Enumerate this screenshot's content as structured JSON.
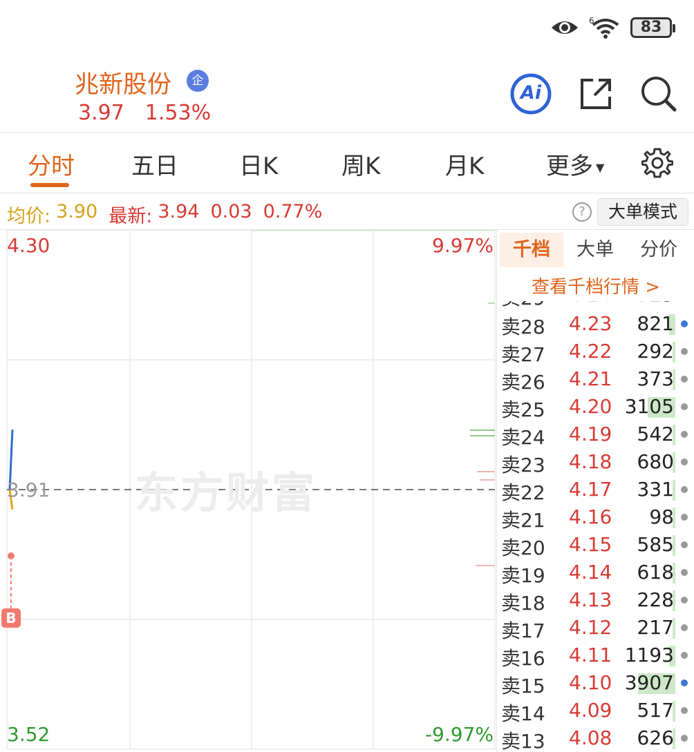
{
  "status": {
    "battery": "83"
  },
  "header": {
    "stock_name": "兆新股份",
    "badge": "企",
    "price": "3.97",
    "change_pct": "1.53%",
    "ai_label": "Ai"
  },
  "tabs": [
    {
      "label": "分时",
      "active": true
    },
    {
      "label": "五日"
    },
    {
      "label": "日K"
    },
    {
      "label": "周K"
    },
    {
      "label": "月K"
    },
    {
      "label": "更多"
    }
  ],
  "infobar": {
    "avg_label": "均价:",
    "avg_value": "3.90",
    "latest_label": "最新:",
    "latest_value": "3.94",
    "change": "0.03",
    "change_pct": "0.77%",
    "help": "?",
    "big_order_mode": "大单模式"
  },
  "chart_data": {
    "type": "line",
    "y_max_label": "4.30",
    "y_min_label": "3.52",
    "pct_max_label": "9.97%",
    "pct_min_label": "-9.97%",
    "prev_close_label": "3.91",
    "ylim": [
      3.52,
      4.3
    ],
    "prev_close": 3.91,
    "price_series": [
      3.91,
      4.0
    ],
    "avg_series": [
      3.91,
      3.88
    ],
    "marker": "B",
    "watermark": "东方财富"
  },
  "orderbook": {
    "tabs": [
      "千档",
      "大单",
      "分价"
    ],
    "view_all": "查看千档行情 >",
    "rows": [
      {
        "label": "卖28",
        "price": "4.23",
        "volume": "821",
        "bar": 0.05,
        "dot": "blue"
      },
      {
        "label": "卖27",
        "price": "4.22",
        "volume": "292",
        "bar": 0.02,
        "dot": "gray"
      },
      {
        "label": "卖26",
        "price": "4.21",
        "volume": "373",
        "bar": 0.02,
        "dot": "gray"
      },
      {
        "label": "卖25",
        "price": "4.20",
        "volume": "3105",
        "bar": 0.22,
        "dot": "gray"
      },
      {
        "label": "卖24",
        "price": "4.19",
        "volume": "542",
        "bar": 0.02,
        "dot": "gray"
      },
      {
        "label": "卖23",
        "price": "4.18",
        "volume": "680",
        "bar": 0.02,
        "dot": "gray"
      },
      {
        "label": "卖22",
        "price": "4.17",
        "volume": "331",
        "bar": 0.02,
        "dot": "gray"
      },
      {
        "label": "卖21",
        "price": "4.16",
        "volume": "98",
        "bar": 0.0,
        "dot": "gray"
      },
      {
        "label": "卖20",
        "price": "4.15",
        "volume": "585",
        "bar": 0.02,
        "dot": "gray"
      },
      {
        "label": "卖19",
        "price": "4.14",
        "volume": "618",
        "bar": 0.02,
        "dot": "gray"
      },
      {
        "label": "卖18",
        "price": "4.13",
        "volume": "228",
        "bar": 0.02,
        "dot": "gray"
      },
      {
        "label": "卖17",
        "price": "4.12",
        "volume": "217",
        "bar": 0.02,
        "dot": "gray"
      },
      {
        "label": "卖16",
        "price": "4.11",
        "volume": "1193",
        "bar": 0.05,
        "dot": "gray"
      },
      {
        "label": "卖15",
        "price": "4.10",
        "volume": "3907",
        "bar": 0.3,
        "dot": "blue"
      },
      {
        "label": "卖14",
        "price": "4.09",
        "volume": "517",
        "bar": 0.02,
        "dot": "gray"
      },
      {
        "label": "卖13",
        "price": "4.08",
        "volume": "626",
        "bar": 0.02,
        "dot": "gray"
      }
    ]
  }
}
